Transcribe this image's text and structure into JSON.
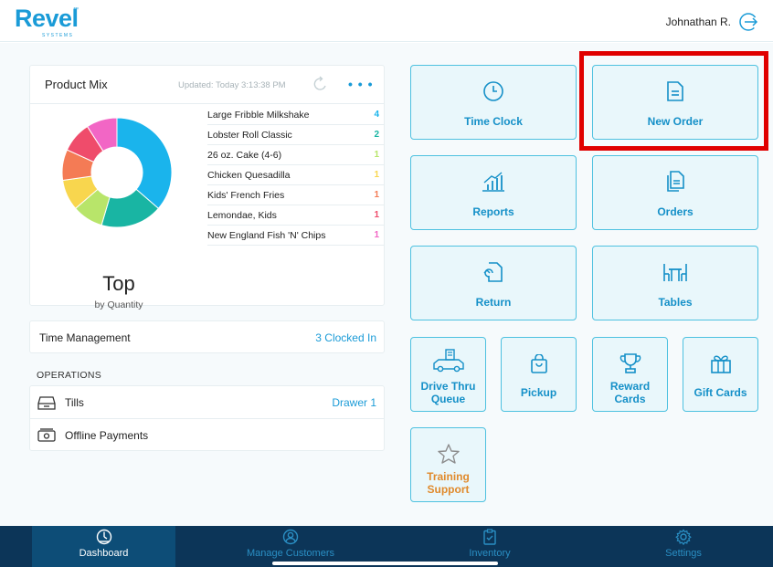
{
  "header": {
    "logo_text": "Revel",
    "logo_sub": "SYSTEMS",
    "user_name": "Johnathan R.",
    "logout_icon": "logout-icon"
  },
  "product_mix": {
    "title": "Product Mix",
    "updated": "Updated: Today 3:13:38 PM",
    "more": "• • •",
    "center_title": "Top",
    "center_sub": "by Quantity",
    "items": [
      {
        "name": "Large Fribble Milkshake",
        "qty": "4",
        "color": "#1ab4ec"
      },
      {
        "name": "Lobster Roll Classic",
        "qty": "2",
        "color": "#19b5a3"
      },
      {
        "name": "26 oz. Cake (4-6)",
        "qty": "1",
        "color": "#b8e56a"
      },
      {
        "name": "Chicken Quesadilla",
        "qty": "1",
        "color": "#f8d64e"
      },
      {
        "name": "Kids' French Fries",
        "qty": "1",
        "color": "#f47b55"
      },
      {
        "name": "Lemondae, Kids",
        "qty": "1",
        "color": "#ef4c6b"
      },
      {
        "name": "New England Fish 'N' Chips",
        "qty": "1",
        "color": "#f266c5"
      }
    ]
  },
  "time_management": {
    "label": "Time Management",
    "value": "3 Clocked In"
  },
  "operations": {
    "label": "OPERATIONS",
    "tills_label": "Tills",
    "tills_value": "Drawer 1",
    "offline_label": "Offline Payments"
  },
  "tiles": {
    "time_clock": "Time Clock",
    "new_order": "New Order",
    "reports": "Reports",
    "orders": "Orders",
    "return": "Return",
    "tables": "Tables",
    "drive_thru_1": "Drive Thru",
    "drive_thru_2": "Queue",
    "pickup": "Pickup",
    "reward_1": "Reward",
    "reward_2": "Cards",
    "gift_cards": "Gift Cards",
    "training_1": "Training",
    "training_2": "Support"
  },
  "colors": {
    "accent": "#1a9bd7",
    "tile_bg": "#e9f7fb",
    "tile_border": "#4ec1e0",
    "training": "#e08a2c",
    "highlight": "#e00000",
    "nav_bg": "#0c3558"
  },
  "nav": {
    "dashboard": "Dashboard",
    "customers": "Manage Customers",
    "inventory": "Inventory",
    "settings": "Settings"
  }
}
